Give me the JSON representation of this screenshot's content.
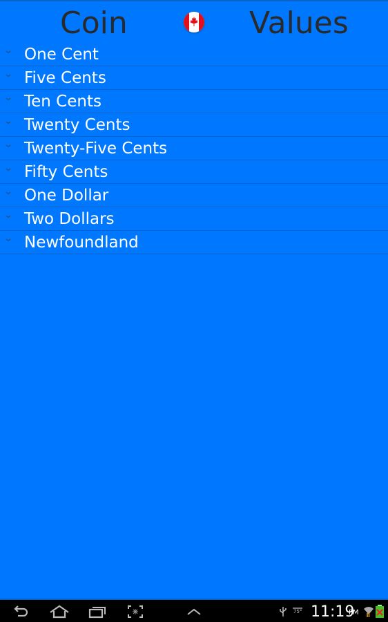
{
  "header": {
    "left_title": "Coin",
    "right_title": "Values",
    "flag_icon": "canada-flag-icon"
  },
  "list": {
    "items": [
      {
        "label": "One Cent",
        "icon": "chevron-down-icon"
      },
      {
        "label": "Five Cents",
        "icon": "chevron-down-icon"
      },
      {
        "label": "Ten Cents",
        "icon": "chevron-down-icon"
      },
      {
        "label": "Twenty Cents",
        "icon": "chevron-down-icon"
      },
      {
        "label": "Twenty-Five Cents",
        "icon": "chevron-down-icon"
      },
      {
        "label": "Fifty Cents",
        "icon": "chevron-down-icon"
      },
      {
        "label": "One Dollar",
        "icon": "chevron-down-icon"
      },
      {
        "label": "Two Dollars",
        "icon": "chevron-down-icon"
      },
      {
        "label": "Newfoundland",
        "icon": "chevron-down-icon"
      }
    ]
  },
  "system_bar": {
    "nav_icons": [
      "back-icon",
      "home-icon",
      "recent-apps-icon",
      "screenshot-icon",
      "menu-up-icon"
    ],
    "status_icons": [
      "usb-icon",
      "temperature-icon",
      "wifi-icon",
      "battery-icon"
    ],
    "temperature": "75°",
    "time": "11:19",
    "ampm": "PM"
  },
  "colors": {
    "background": "#0077ff",
    "divider": "#0a63c9",
    "header_text": "#2a2a2a",
    "item_text": "#ffffff",
    "nav_bar": "#000000"
  }
}
